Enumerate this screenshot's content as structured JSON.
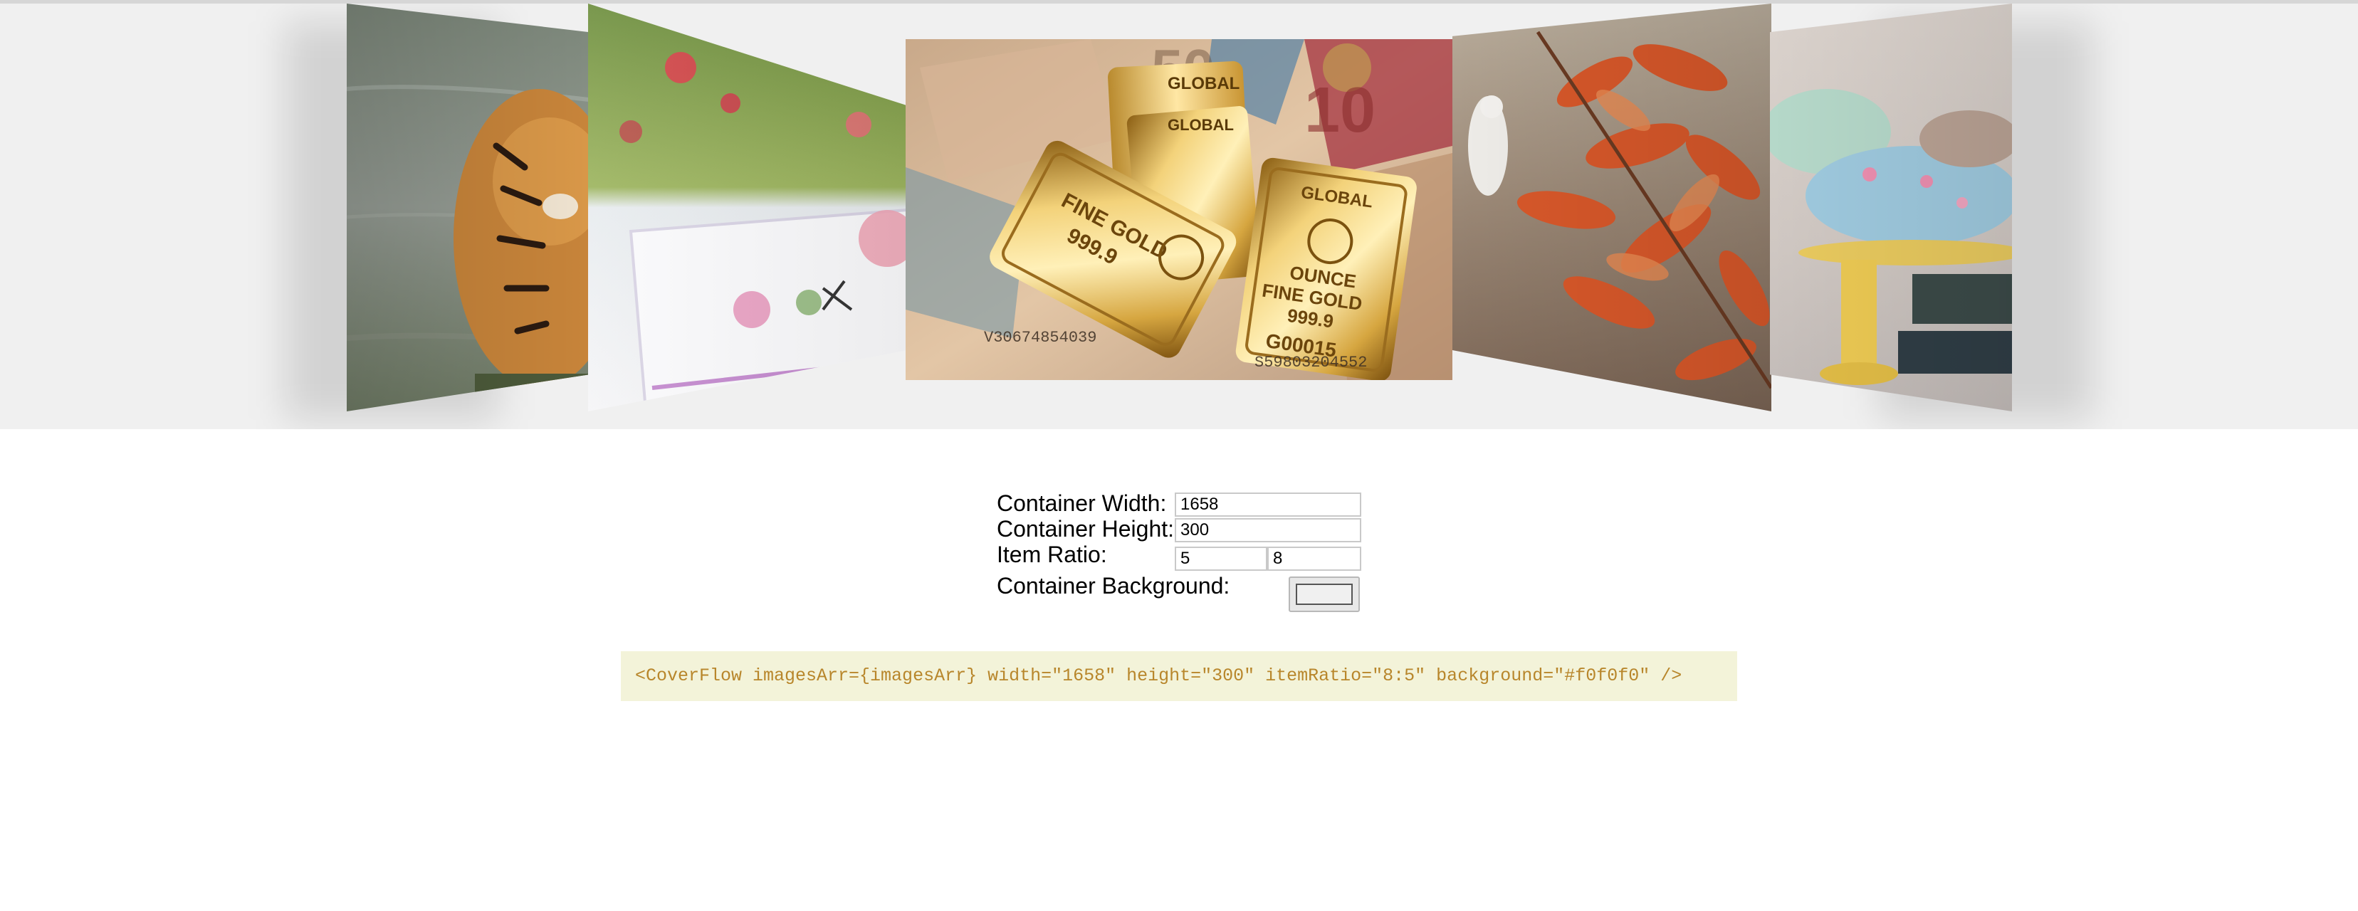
{
  "coverflow": {
    "background": "#f0f0f0",
    "items": [
      {
        "name": "tiger",
        "position": "far-left"
      },
      {
        "name": "embroidered-napkin-flowers",
        "position": "left"
      },
      {
        "name": "gold-bars-euro-notes",
        "position": "center"
      },
      {
        "name": "autumn-leaves-bird",
        "position": "right"
      },
      {
        "name": "cupcakes-cake-stand",
        "position": "far-right"
      }
    ],
    "gold_bar_texts": {
      "brand": "GLOBAL",
      "fine_gold": "FINE GOLD",
      "ounce": "OUNCE",
      "purity": "999.9",
      "serial": "G00015",
      "banknote_serial_1": "V30674854039",
      "banknote_serial_2": "S59803204552"
    }
  },
  "form": {
    "width_label": "Container Width:",
    "width_value": "1658",
    "height_label": "Container Height:",
    "height_value": "300",
    "ratio_label": "Item Ratio:",
    "ratio_a": "5",
    "ratio_b": "8",
    "background_label": "Container Background:",
    "background_value": "#f0f0f0"
  },
  "code_snippet": "<CoverFlow imagesArr={imagesArr} width=\"1658\" height=\"300\" itemRatio=\"8:5\" background=\"#f0f0f0\" />"
}
